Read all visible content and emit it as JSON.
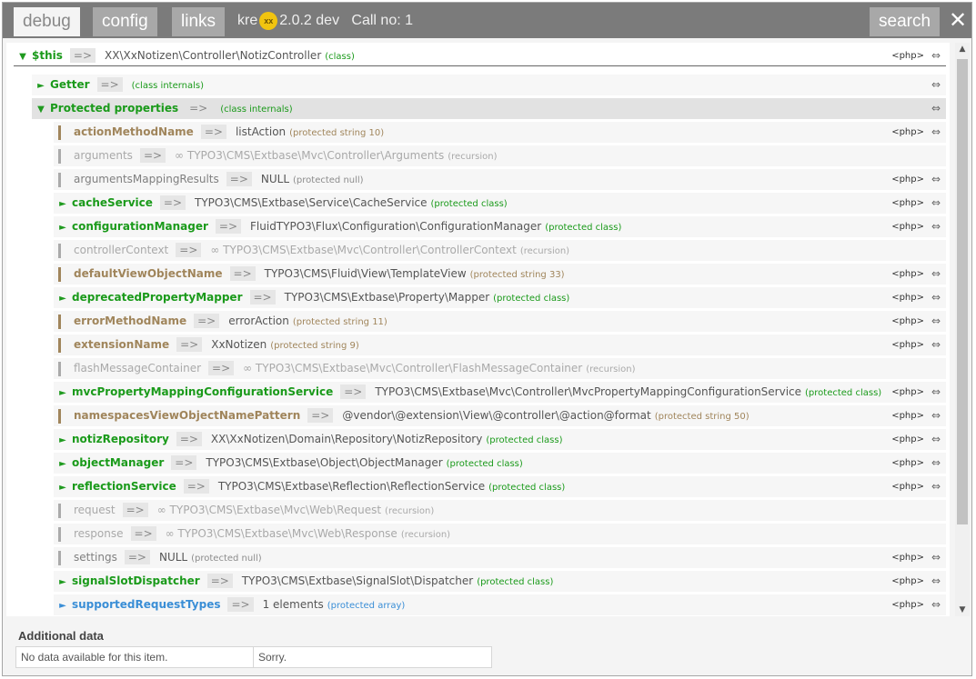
{
  "header": {
    "tabs": [
      {
        "label": "debug",
        "active": true
      },
      {
        "label": "config",
        "active": false
      },
      {
        "label": "links",
        "active": false
      }
    ],
    "app_name": "kre",
    "logo_text": "xx",
    "version": "2.0.2 dev",
    "call_no": "Call no: 1",
    "search_label": "search",
    "close_glyph": "✕"
  },
  "tree": {
    "root": {
      "name": "$this",
      "arrow": "=>",
      "value": "XX\\XxNotizen\\Controller\\NotizController",
      "note": "(class)",
      "php": "<php>",
      "dbl": "⇔"
    },
    "getter": {
      "name": "Getter",
      "arrow": "=>",
      "note": "(class internals)",
      "dbl": "⇔"
    },
    "protected": {
      "name": "Protected properties",
      "arrow": "=>",
      "note": "(class internals)",
      "dbl": "⇔"
    },
    "props": [
      {
        "kind": "brown",
        "name": "actionMethodName",
        "value": "listAction",
        "note": "(protected string 10)",
        "php": true
      },
      {
        "kind": "recur",
        "name": "arguments",
        "value": "∞  TYPO3\\CMS\\Extbase\\Mvc\\Controller\\Arguments",
        "note": "(recursion)",
        "php": false
      },
      {
        "kind": "gray",
        "name": "argumentsMappingResults",
        "value": "NULL",
        "note": "(protected null)",
        "php": true
      },
      {
        "kind": "green",
        "name": "cacheService",
        "value": "TYPO3\\CMS\\Extbase\\Service\\CacheService",
        "note": "(protected class)",
        "php": true
      },
      {
        "kind": "green",
        "name": "configurationManager",
        "value": "FluidTYPO3\\Flux\\Configuration\\ConfigurationManager",
        "note": "(protected class)",
        "php": true
      },
      {
        "kind": "recur",
        "name": "controllerContext",
        "value": "∞  TYPO3\\CMS\\Extbase\\Mvc\\Controller\\ControllerContext",
        "note": "(recursion)",
        "php": false
      },
      {
        "kind": "brown",
        "name": "defaultViewObjectName",
        "value": "TYPO3\\CMS\\Fluid\\View\\TemplateView",
        "note": "(protected string 33)",
        "php": true
      },
      {
        "kind": "green",
        "name": "deprecatedPropertyMapper",
        "value": "TYPO3\\CMS\\Extbase\\Property\\Mapper",
        "note": "(protected class)",
        "php": true
      },
      {
        "kind": "brown",
        "name": "errorMethodName",
        "value": "errorAction",
        "note": "(protected string 11)",
        "php": true
      },
      {
        "kind": "brown",
        "name": "extensionName",
        "value": "XxNotizen",
        "note": "(protected string 9)",
        "php": true
      },
      {
        "kind": "recur",
        "name": "flashMessageContainer",
        "value": "∞  TYPO3\\CMS\\Extbase\\Mvc\\Controller\\FlashMessageContainer",
        "note": "(recursion)",
        "php": false
      },
      {
        "kind": "green",
        "name": "mvcPropertyMappingConfigurationService",
        "value": "TYPO3\\CMS\\Extbase\\Mvc\\Controller\\MvcPropertyMappingConfigurationService",
        "note": "(protected class)",
        "php": true
      },
      {
        "kind": "brown",
        "name": "namespacesViewObjectNamePattern",
        "value": "@vendor\\@extension\\View\\@controller\\@action@format",
        "note": "(protected string 50)",
        "php": true
      },
      {
        "kind": "green",
        "name": "notizRepository",
        "value": "XX\\XxNotizen\\Domain\\Repository\\NotizRepository",
        "note": "(protected class)",
        "php": true
      },
      {
        "kind": "green",
        "name": "objectManager",
        "value": "TYPO3\\CMS\\Extbase\\Object\\ObjectManager",
        "note": "(protected class)",
        "php": true
      },
      {
        "kind": "green",
        "name": "reflectionService",
        "value": "TYPO3\\CMS\\Extbase\\Reflection\\ReflectionService",
        "note": "(protected class)",
        "php": true
      },
      {
        "kind": "recur",
        "name": "request",
        "value": "∞  TYPO3\\CMS\\Extbase\\Mvc\\Web\\Request",
        "note": "(recursion)",
        "php": false
      },
      {
        "kind": "recur",
        "name": "response",
        "value": "∞  TYPO3\\CMS\\Extbase\\Mvc\\Web\\Response",
        "note": "(recursion)",
        "php": false
      },
      {
        "kind": "gray",
        "name": "settings",
        "value": "NULL",
        "note": "(protected null)",
        "php": true
      },
      {
        "kind": "green",
        "name": "signalSlotDispatcher",
        "value": "TYPO3\\CMS\\Extbase\\SignalSlot\\Dispatcher",
        "note": "(protected class)",
        "php": true
      },
      {
        "kind": "blue",
        "name": "supportedRequestTypes",
        "value": "1 elements",
        "note": "(protected array)",
        "php": true
      }
    ],
    "arrow": "=>",
    "php_label": "<php>",
    "dbl_glyph": "⇔"
  },
  "footer": {
    "title": "Additional data",
    "cell1": "No data available for this item.",
    "cell2": "Sorry."
  }
}
